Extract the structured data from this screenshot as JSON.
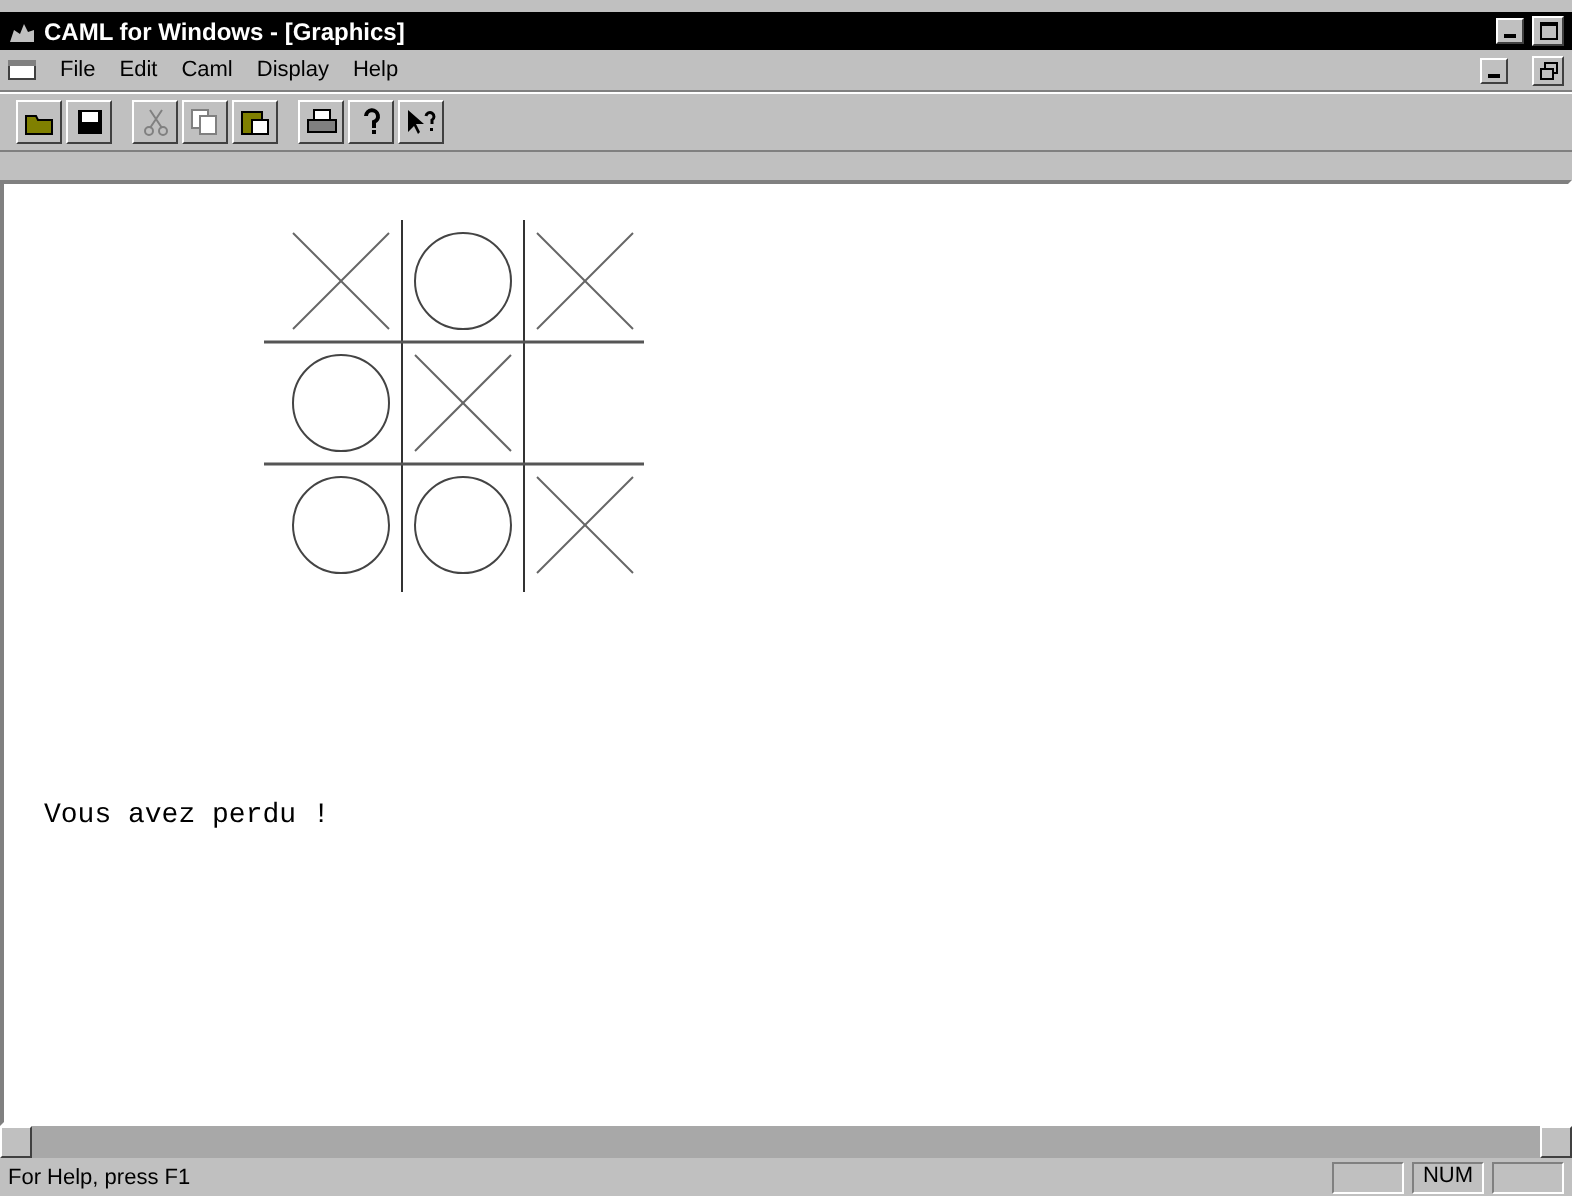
{
  "window": {
    "title": "CAML for Windows - [Graphics]"
  },
  "menu": [
    {
      "label": "File"
    },
    {
      "label": "Edit"
    },
    {
      "label": "Caml"
    },
    {
      "label": "Display"
    },
    {
      "label": "Help"
    }
  ],
  "toolbar": [
    {
      "kind": "open",
      "disabled": false
    },
    {
      "kind": "save",
      "disabled": false
    },
    {
      "kind": "cut",
      "disabled": true
    },
    {
      "kind": "copy",
      "disabled": true
    },
    {
      "kind": "paste",
      "disabled": false
    },
    {
      "kind": "print",
      "disabled": false
    },
    {
      "kind": "help",
      "disabled": false
    },
    {
      "kind": "context-help",
      "disabled": false
    }
  ],
  "board": [
    {
      "kind": "x"
    },
    {
      "kind": "o"
    },
    {
      "kind": "x"
    },
    {
      "kind": "o"
    },
    {
      "kind": "x"
    },
    {
      "kind": "empty"
    },
    {
      "kind": "o"
    },
    {
      "kind": "o"
    },
    {
      "kind": "x"
    }
  ],
  "message": "Vous avez perdu !",
  "status_bar": {
    "text": "For Help, press F1",
    "indicators": [
      "NUM"
    ]
  }
}
